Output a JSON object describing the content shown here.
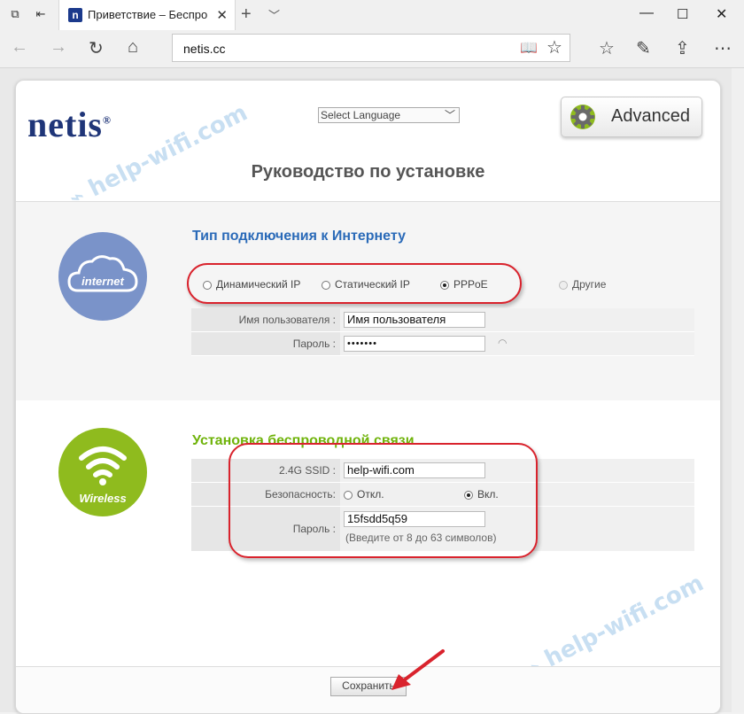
{
  "browser": {
    "tab_title": "Приветствие – Беспроводн",
    "address": "netis.cc"
  },
  "header": {
    "logo": "netis",
    "language_select": "Select Language",
    "advanced_button": "Advanced",
    "page_heading": "Руководство по установке"
  },
  "internet": {
    "icon_label": "internet",
    "section_title": "Тип подключения к Интернету",
    "options": [
      "Динамический IP",
      "Статический IP",
      "PPPoE",
      "Другие"
    ],
    "selected": "PPPoE",
    "username_label": "Имя пользователя :",
    "username_value": "Имя пользователя",
    "password_label": "Пароль :",
    "password_value": "•••••••"
  },
  "wireless": {
    "icon_label": "Wireless",
    "section_title": "Установка беспроводной связи",
    "ssid_label": "2.4G SSID :",
    "ssid_value": "help-wifi.com",
    "security_label": "Безопасность:",
    "security_off": "Откл.",
    "security_on": "Вкл.",
    "security_selected": "Вкл.",
    "password_label": "Пароль :",
    "password_value": "15fsdd5q59",
    "password_hint": "(Введите от 8 до 63 символов)"
  },
  "footer": {
    "save_button": "Сохранить"
  },
  "watermark": "help-wifi.com",
  "colors": {
    "logo_blue": "#1f3578",
    "internet_circle": "#7a93c9",
    "wireless_circle": "#8fbb1e",
    "internet_title": "#2a6ab8",
    "wireless_title": "#6fb30a",
    "highlight_red": "#d9232d"
  }
}
